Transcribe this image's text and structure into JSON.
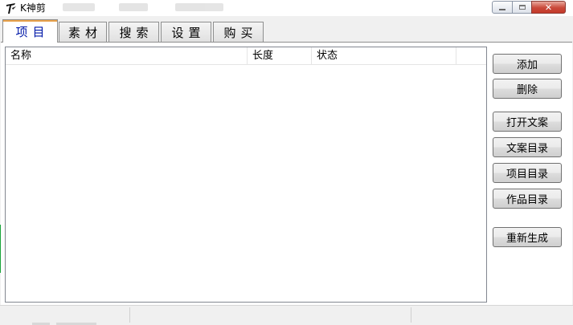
{
  "window": {
    "title": "K神剪",
    "app_icon": "k-logo-icon",
    "controls": {
      "minimize": "minimize-icon",
      "maximize": "maximize-icon",
      "close": "close-icon"
    }
  },
  "tabs": [
    {
      "label": "项目",
      "active": true
    },
    {
      "label": "素材",
      "active": false
    },
    {
      "label": "搜索",
      "active": false
    },
    {
      "label": "设置",
      "active": false
    },
    {
      "label": "购买",
      "active": false
    }
  ],
  "project_list": {
    "columns": [
      "名称",
      "长度",
      "状态",
      ""
    ],
    "rows": []
  },
  "side_buttons": {
    "add": "添加",
    "delete": "删除",
    "open_script": "打开文案",
    "script_folder": "文案目录",
    "project_folder": "项目目录",
    "works_folder": "作品目录",
    "regenerate": "重新生成"
  },
  "status_bar": {
    "panel1": "",
    "panel2": "",
    "panel3": ""
  },
  "colors": {
    "active_tab_text": "#0018a8",
    "active_tab_accent": "#e8a14a",
    "close_button": "#c9493a"
  }
}
